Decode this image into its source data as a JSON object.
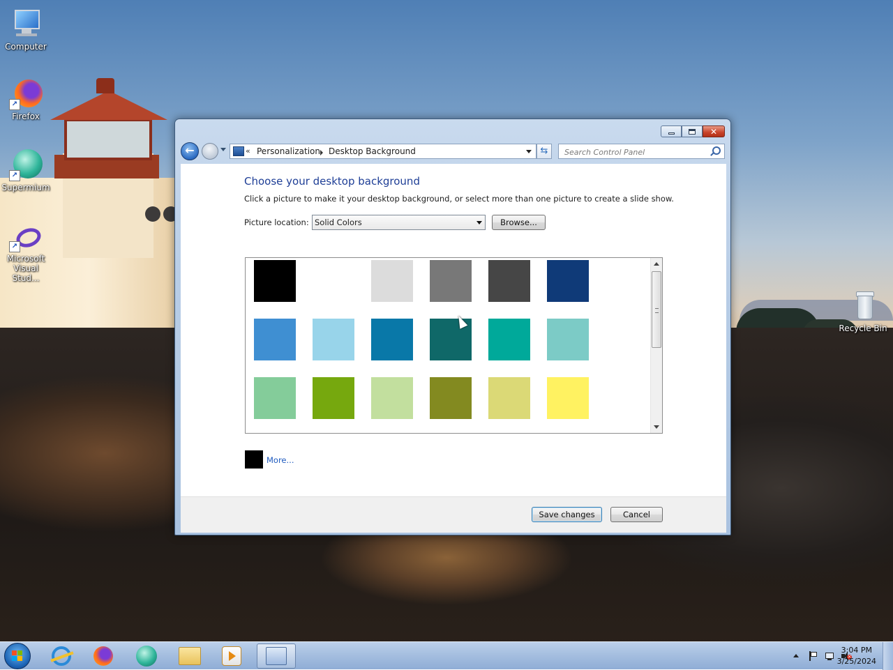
{
  "desktop": {
    "icons": [
      {
        "label": "Computer"
      },
      {
        "label": "Firefox"
      },
      {
        "label": "Supermium"
      },
      {
        "label": "Microsoft Visual Stud..."
      },
      {
        "label": "Recycle Bin"
      }
    ]
  },
  "window": {
    "address": {
      "chevron": "«",
      "crumbs": [
        "Personalization",
        "Desktop Background"
      ]
    },
    "search": {
      "placeholder": "Search Control Panel"
    },
    "heading": "Choose your desktop background",
    "description": "Click a picture to make it your desktop background, or select more than one picture to create a slide show.",
    "location": {
      "label": "Picture location:",
      "selected": "Solid Colors",
      "browse_label": "Browse..."
    },
    "colors": [
      [
        "#000000",
        "#ffffff",
        "#dcdcdc",
        "#787878",
        "#464646",
        "#0f3a78"
      ],
      [
        "#3f8fd2",
        "#98d4ea",
        "#0978a8",
        "#0f6868",
        "#00a99a",
        "#7ccbc6"
      ],
      [
        "#84cc9a",
        "#76a80e",
        "#c2df9e",
        "#838a20",
        "#dbd976",
        "#fff261"
      ]
    ],
    "more_color": "#000000",
    "more_label": "More...",
    "save_label": "Save changes",
    "cancel_label": "Cancel"
  },
  "taskbar": {
    "clock_time": "3:04 PM",
    "clock_date": "3/25/2024"
  }
}
